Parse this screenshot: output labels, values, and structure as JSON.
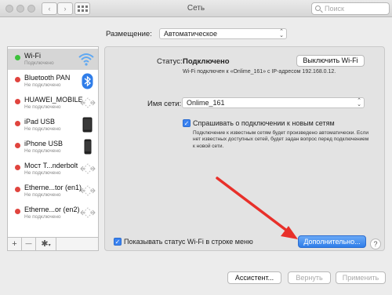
{
  "window": {
    "title": "Сеть"
  },
  "search": {
    "placeholder": "Поиск"
  },
  "location": {
    "label": "Размещение:",
    "value": "Автоматическое"
  },
  "services": [
    {
      "name": "Wi-Fi",
      "status": "Подключено",
      "status_color": "#3cc13b",
      "icon": "wifi-icon"
    },
    {
      "name": "Bluetooth PAN",
      "status": "Не подключено",
      "status_color": "#e0443e",
      "icon": "bluetooth-icon"
    },
    {
      "name": "HUAWEI_MOBILE",
      "status": "Не подключено",
      "status_color": "#e0443e",
      "icon": "arrows-icon"
    },
    {
      "name": "iPad USB",
      "status": "Не подключено",
      "status_color": "#e0443e",
      "icon": "ipad-icon"
    },
    {
      "name": "iPhone USB",
      "status": "Не подключено",
      "status_color": "#e0443e",
      "icon": "iphone-icon"
    },
    {
      "name": "Мост T...nderbolt",
      "status": "Не подключено",
      "status_color": "#e0443e",
      "icon": "arrows-icon"
    },
    {
      "name": "Etherne...tor (en1)",
      "status": "Не подключено",
      "status_color": "#e0443e",
      "icon": "arrows-icon"
    },
    {
      "name": "Etherne...or (en2)",
      "status": "Не подключено",
      "status_color": "#e0443e",
      "icon": "arrows-icon"
    }
  ],
  "toolbar": {
    "add": "+",
    "remove": "—",
    "gear": "✱"
  },
  "status": {
    "label": "Статус:",
    "value": "Подключено",
    "turn_off_button": "Выключить Wi-Fi",
    "description": "Wi-Fi подключен к «Onlime_161» с IP-адресом 192.168.0.12."
  },
  "network": {
    "label": "Имя сети:",
    "value": "Onlime_161"
  },
  "ask": {
    "label": "Спрашивать о подключении к новым сетям",
    "description": "Подключение к известным сетям будет произведено автоматически. Если нет известных доступных сетей, будет задан вопрос перед подключением к новой сети."
  },
  "show_status": {
    "label": "Показывать статус Wi-Fi в строке меню"
  },
  "buttons": {
    "advanced": "Дополнительно...",
    "help": "?",
    "assistant": "Ассистент...",
    "revert": "Вернуть",
    "apply": "Применить"
  },
  "colors": {
    "accent": "#2f7de9",
    "annotation_arrow": "#e8302a"
  }
}
